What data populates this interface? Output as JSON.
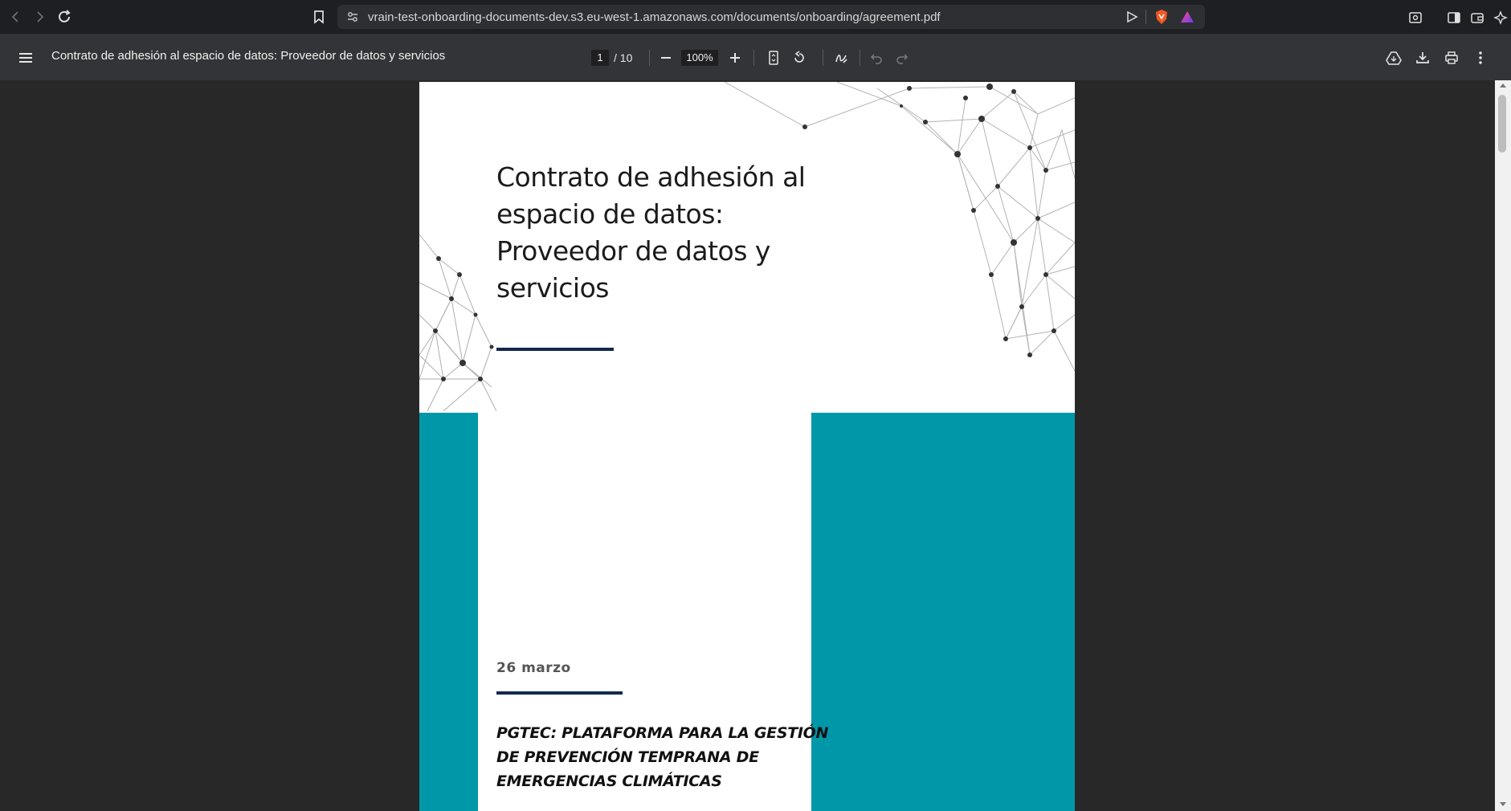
{
  "browser": {
    "url": "vrain-test-onboarding-documents-dev.s3.eu-west-1.amazonaws.com/documents/onboarding/agreement.pdf"
  },
  "pdf_toolbar": {
    "title": "Contrato de adhesión al espacio de datos: Proveedor de datos y servicios",
    "current_page": "1",
    "total_pages": "/ 10",
    "zoom": "100%"
  },
  "document": {
    "title": "Contrato de adhesión al espacio de datos: Proveedor de datos y servicios",
    "date": "26 marzo",
    "subtitle": "PGTEC: PLATAFORMA PARA LA GESTIÓN DE PREVENCIÓN TEMPRANA DE EMERGENCIAS CLIMÁTICAS"
  },
  "colors": {
    "accent_teal": "#0097a9",
    "rule_navy": "#13294b",
    "toolbar": "#333437",
    "viewer_bg": "#282828"
  },
  "icons": [
    "back-icon",
    "forward-icon",
    "reload-icon",
    "bookmark-icon",
    "site-info-icon",
    "send-icon",
    "brave-shield-icon",
    "brave-rewards-icon",
    "screenshot-icon",
    "sidebar-icon",
    "wallet-icon",
    "leo-icon",
    "menu-icon",
    "zoom-out-icon",
    "zoom-in-icon",
    "fit-page-icon",
    "rotate-icon",
    "annotate-icon",
    "undo-icon",
    "redo-icon",
    "save-drive-icon",
    "download-icon",
    "print-icon",
    "more-icon"
  ]
}
